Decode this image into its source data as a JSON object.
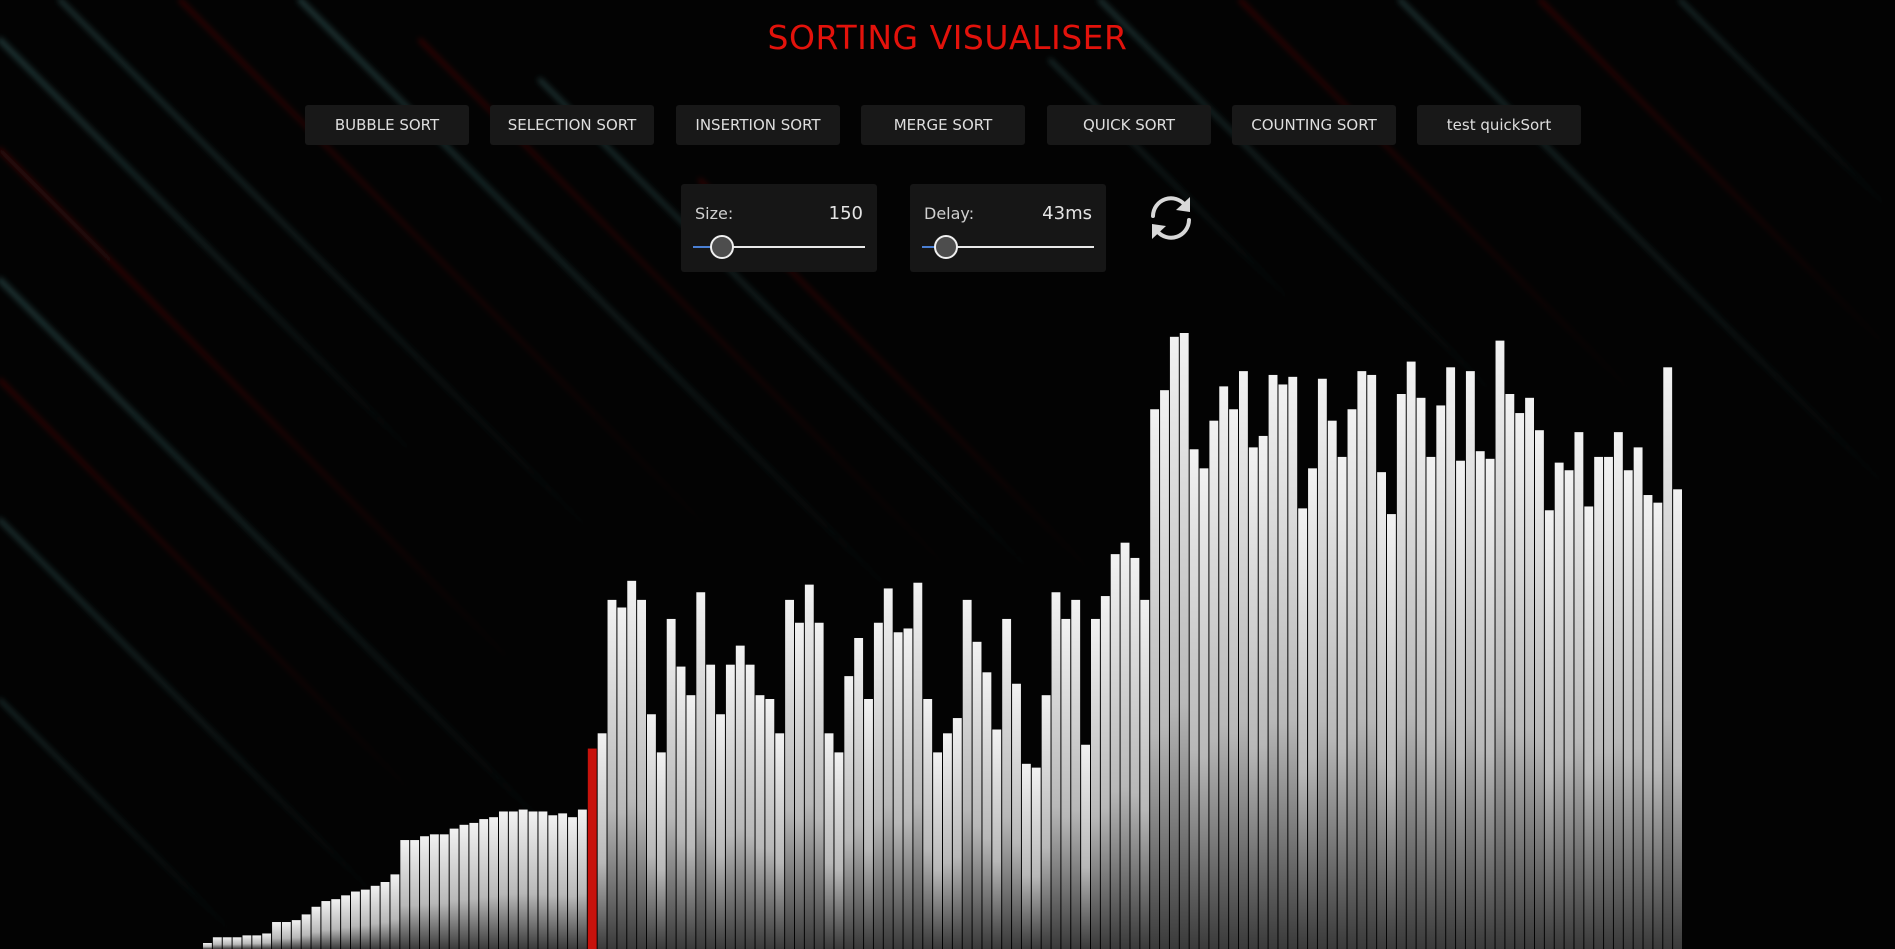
{
  "app": {
    "title": "SORTING VISUALISER",
    "title_color": "#e3120b"
  },
  "algorithms": [
    {
      "label": "BUBBLE SORT"
    },
    {
      "label": "SELECTION SORT"
    },
    {
      "label": "INSERTION SORT"
    },
    {
      "label": "MERGE SORT"
    },
    {
      "label": "QUICK SORT"
    },
    {
      "label": "COUNTING SORT"
    },
    {
      "label": "test quickSort"
    }
  ],
  "controls": {
    "size": {
      "label": "Size:",
      "value": "150",
      "fraction": 0.17
    },
    "delay": {
      "label": "Delay:",
      "value": "43ms",
      "fraction": 0.14
    },
    "reset_icon": "refresh-icon"
  },
  "visualizer": {
    "highlight_color": "#c8120c",
    "bar_color": "#cfcfcf",
    "highlight_index": 39,
    "values": [
      0,
      3,
      3,
      3,
      4,
      4,
      5,
      11,
      11,
      12,
      15,
      19,
      22,
      23,
      25,
      27,
      28,
      30,
      32,
      36,
      54,
      54,
      56,
      57,
      57,
      60,
      62,
      63,
      65,
      66,
      69,
      69,
      70,
      69,
      69,
      67,
      68,
      66,
      70,
      102,
      110,
      180,
      176,
      190,
      180,
      120,
      100,
      170,
      145,
      130,
      184,
      146,
      120,
      146,
      156,
      146,
      130,
      128,
      110,
      180,
      168,
      188,
      168,
      110,
      100,
      140,
      160,
      128,
      168,
      186,
      163,
      165,
      189,
      128,
      100,
      110,
      118,
      180,
      158,
      142,
      112,
      170,
      136,
      94,
      92,
      130,
      184,
      170,
      180,
      104,
      170,
      182,
      204,
      210,
      202,
      180,
      280,
      290,
      318,
      320,
      259,
      249,
      274,
      292,
      280,
      300,
      260,
      266,
      298,
      293,
      297,
      228,
      249,
      296,
      274,
      255,
      280,
      300,
      298,
      247,
      225,
      288,
      305,
      286,
      255,
      282,
      302,
      253,
      300,
      258,
      254,
      316,
      288,
      278,
      286,
      269,
      227,
      252,
      248,
      268,
      229,
      255,
      255,
      268,
      248,
      260,
      235,
      231,
      302,
      238
    ]
  }
}
